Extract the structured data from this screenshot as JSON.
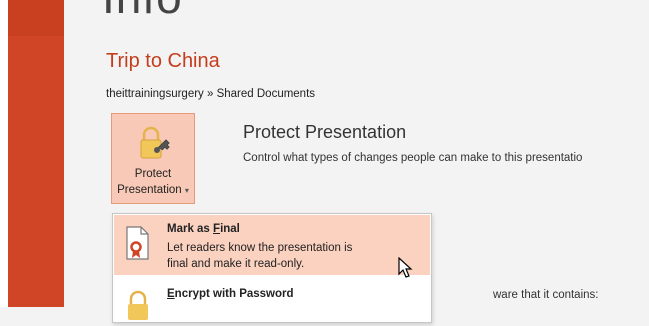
{
  "page": {
    "heading": "Info",
    "doc_title": "Trip to China",
    "doc_path": "theittrainingsurgery » Shared Documents"
  },
  "protect": {
    "button_label_line1": "Protect",
    "button_label_line2": "Presentation",
    "caret": "▾",
    "section_title": "Protect Presentation",
    "section_desc": "Control what types of changes people can make to this presentatio",
    "icon": "lock-key-icon"
  },
  "menu": {
    "items": [
      {
        "title_pre": "Mark as ",
        "title_underline": "F",
        "title_post": "inal",
        "desc_line1": "Let readers know the presentation is",
        "desc_line2": "final and make it read-only.",
        "icon": "mark-final-icon"
      },
      {
        "title_pre": "",
        "title_underline": "E",
        "title_post": "ncrypt with Password",
        "icon": "lock-icon"
      }
    ]
  },
  "background_text": "ware that it contains:",
  "colors": {
    "accent": "#d04525",
    "title": "#c43e1c",
    "highlight": "#fbd1c0",
    "button_bg": "#f8c9b6"
  }
}
